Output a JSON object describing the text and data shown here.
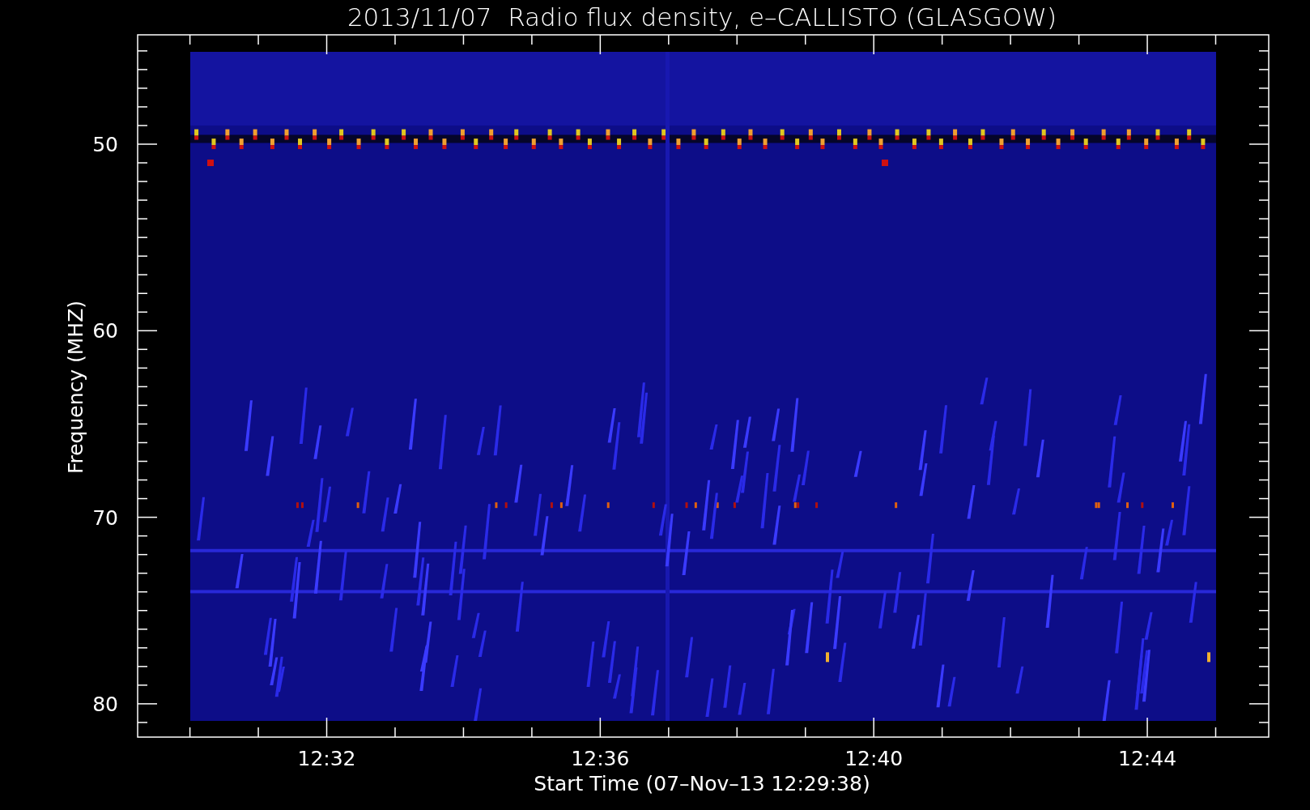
{
  "title": "2013/11/07  Radio flux density, e–CALLISTO (GLASGOW)",
  "y_axis": {
    "label": "Frequency (MHZ)",
    "tick_labels": [
      "50",
      "60",
      "70",
      "80"
    ]
  },
  "x_axis": {
    "label": "Start Time (07–Nov–13 12:29:38)",
    "tick_labels": [
      "12:32",
      "12:36",
      "12:40",
      "12:44"
    ]
  }
}
